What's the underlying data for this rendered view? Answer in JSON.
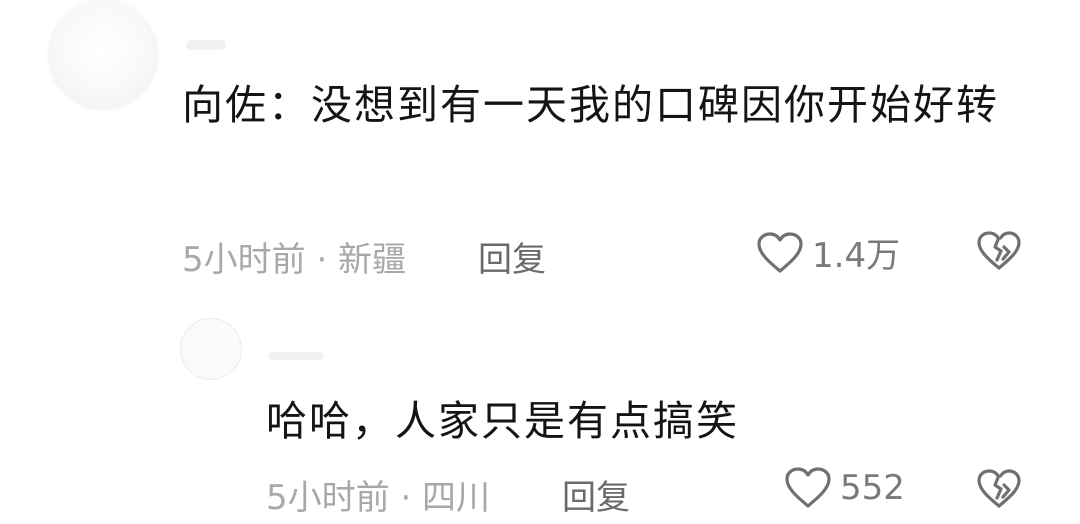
{
  "comments": [
    {
      "text": "向佐：没想到有一天我的口碑因你开始好转",
      "meta": "5小时前 · 新疆",
      "reply_label": "回复",
      "likes": "1.4万"
    },
    {
      "text": "哈哈，人家只是有点搞笑",
      "meta": "5小时前 · 四川",
      "reply_label": "回复",
      "likes": "552"
    }
  ],
  "icons": {
    "like": "heart-outline-icon",
    "dislike": "broken-heart-icon"
  },
  "colors": {
    "text": "#141414",
    "meta": "#a8a8a8",
    "icon": "#707070"
  }
}
